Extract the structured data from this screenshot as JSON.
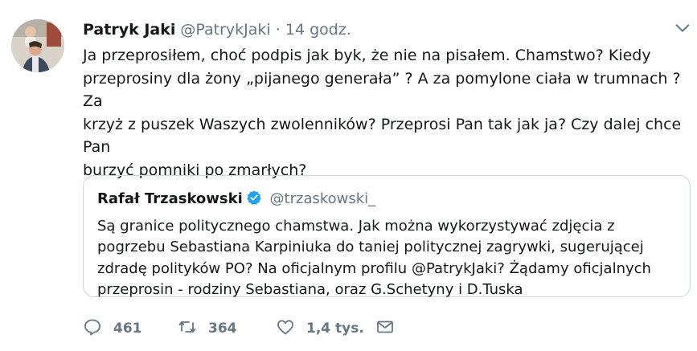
{
  "tweet": {
    "author_name": "Patryk Jaki",
    "author_handle": "@PatrykJaki",
    "separator": "·",
    "timestamp": "14 godz.",
    "text": "Ja przeprosiłem, choć podpis jak byk, że nie na pisałem. Chamstwo? Kiedy\nprzeprosiny dla żony „pijanego generała” ? A za pomylone ciała w trumnach ? Za\nkrzyż z puszek Waszych zwolenników? Przeprosi Pan tak jak ja? Czy dalej chce Pan\nburzyć pomniki po zmarłych?"
  },
  "quoted_tweet": {
    "author_name": "Rafał Trzaskowski",
    "author_handle": "@trzaskowski_",
    "verified": true,
    "text": "Są granice politycznego chamstwa. Jak można wykorzystywać zdjęcia z\npogrzebu Sebastiana Karpiniuka do taniej politycznej zagrywki, sugerującej\nzdradę polityków PO? Na oficjalnym profilu @PatrykJaki? Żądamy oficjalnych\nprzeprosin - rodziny Sebastiana, oraz G.Schetyny i D.Tuska"
  },
  "actions": {
    "reply": {
      "icon": "reply-icon",
      "count": "461"
    },
    "retweet": {
      "icon": "retweet-icon",
      "count": "364"
    },
    "like": {
      "icon": "heart-icon",
      "count": "1,4 tys."
    },
    "message": {
      "icon": "envelope-icon"
    }
  },
  "colors": {
    "text": "#14171a",
    "muted": "#657786",
    "border": "#ccd6dd",
    "verified": "#1da1f2"
  }
}
